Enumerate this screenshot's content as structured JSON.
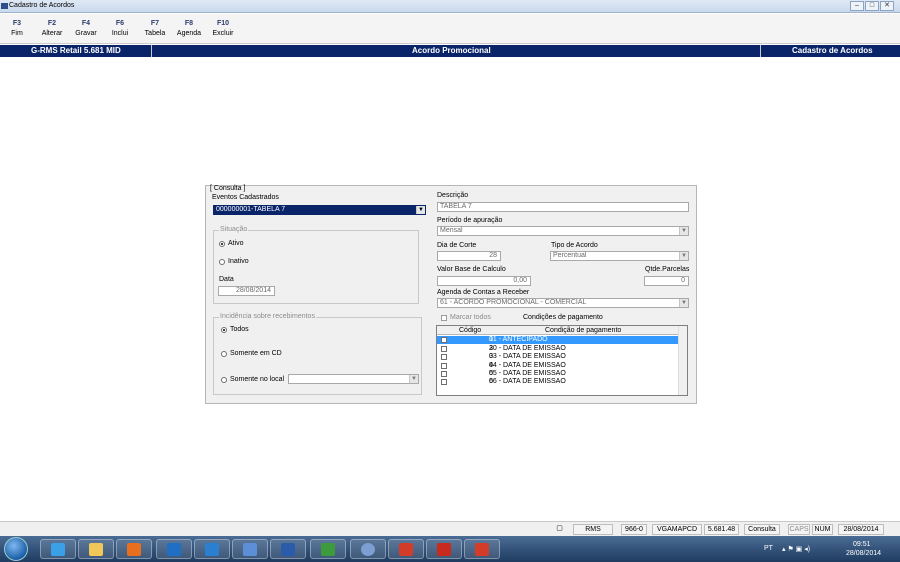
{
  "window": {
    "title": "Cadastro de Acordos"
  },
  "toolbar": [
    {
      "key": "F3",
      "label": "Fim"
    },
    {
      "key": "F2",
      "label": "Alterar"
    },
    {
      "key": "F4",
      "label": "Gravar"
    },
    {
      "key": "F6",
      "label": "Inclui"
    },
    {
      "key": "F7",
      "label": "Tabela"
    },
    {
      "key": "F8",
      "label": "Agenda"
    },
    {
      "key": "F10",
      "label": "Excluir"
    }
  ],
  "header": {
    "left": "G-RMS Retail 5.681 MID",
    "center": "Acordo Promocional",
    "right": "Cadastro de Acordos"
  },
  "form": {
    "consulta_caption": "[ Consulta ]",
    "eventos_label": "Eventos Cadastrados",
    "eventos_value": "000000001-TABELA 7",
    "situacao_caption": "Situação",
    "ativo_label": "Ativo",
    "inativo_label": "Inativo",
    "data_label": "Data",
    "data_value": "28/08/2014",
    "incidencia_caption": "Incidência sobre recebimentos",
    "todos_label": "Todos",
    "somente_cd_label": "Somente em CD",
    "somente_local_label": "Somente no local",
    "descricao_label": "Descrição",
    "descricao_value": "TABELA 7",
    "periodo_label": "Período de apuração",
    "periodo_value": "Mensal",
    "dia_corte_label": "Dia de Corte",
    "dia_corte_value": "28",
    "tipo_acordo_label": "Tipo de Acordo",
    "tipo_acordo_value": "Percentual",
    "valor_base_label": "Valor Base de Calculo",
    "valor_base_value": "0,00",
    "qtde_parcelas_label": "Qtde.Parcelas",
    "qtde_parcelas_value": "0",
    "agenda_label": "Agenda de Contas a Receber",
    "agenda_value": "61 - ACORDO PROMOCIONAL - COMERCIAL",
    "marcar_todos_label": "Marcar todos",
    "condicoes_title": "Condições de pagamento",
    "grid_headers": {
      "codigo": "Código",
      "condicao": "Condição de pagamento"
    },
    "grid_rows": [
      {
        "codigo": "1",
        "condicao": "01 - ANTECIPADO",
        "selected": true
      },
      {
        "codigo": "2",
        "condicao": "30 - DATA DE EMISSAO",
        "selected": false
      },
      {
        "codigo": "3",
        "condicao": "03 - DATA DE EMISSAO",
        "selected": false
      },
      {
        "codigo": "4",
        "condicao": "04 - DATA DE EMISSAO",
        "selected": false
      },
      {
        "codigo": "5",
        "condicao": "05 - DATA DE EMISSAO",
        "selected": false
      },
      {
        "codigo": "6",
        "condicao": "06 - DATA DE EMISSAO",
        "selected": false
      }
    ]
  },
  "statusbar": {
    "app": "RMS",
    "code": "966-0",
    "user": "VGAMAPCD",
    "version": "5.681.48",
    "mode": "Consulta",
    "caps": "CAPS",
    "num": "NUM",
    "date": "28/08/2014"
  },
  "taskbar": {
    "lang": "PT",
    "time": "09:51",
    "date": "28/08/2014"
  },
  "colors": {
    "header_blue": "#0a246a",
    "selection": "#3399ff"
  }
}
